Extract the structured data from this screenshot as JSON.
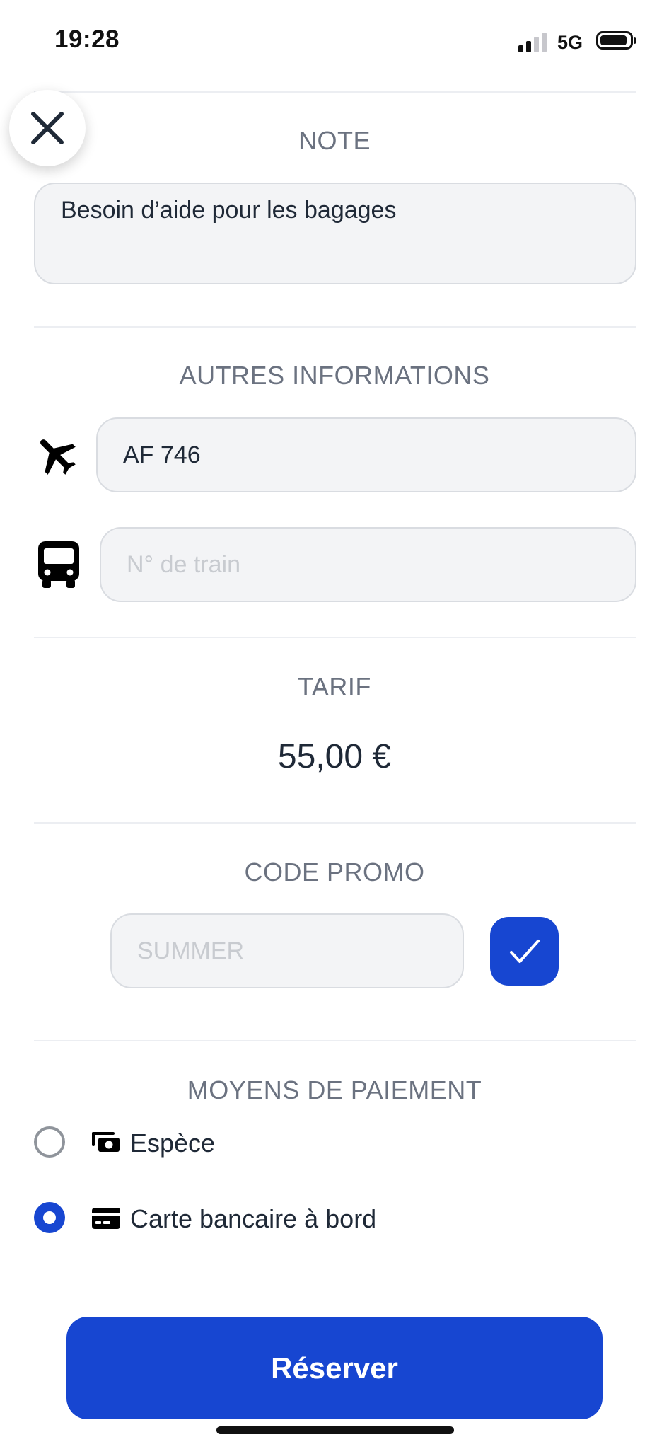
{
  "status_bar": {
    "time": "19:28",
    "network": "5G"
  },
  "note": {
    "title": "NOTE",
    "value": "Besoin d’aide pour les bagages"
  },
  "other_info": {
    "title": "AUTRES INFORMATIONS",
    "flight_value": "AF 746",
    "train_placeholder": "N° de train",
    "flight_icon": "airplane-icon",
    "train_icon": "bus-icon"
  },
  "tarif": {
    "title": "TARIF",
    "price": "55,00 €"
  },
  "promo": {
    "title": "CODE PROMO",
    "placeholder": "SUMMER",
    "confirm_icon": "checkmark-icon"
  },
  "payment": {
    "title": "MOYENS DE PAIEMENT",
    "options": [
      {
        "label": "Espèce",
        "icon": "cash-icon",
        "selected": false
      },
      {
        "label": "Carte bancaire à bord",
        "icon": "credit-card-icon",
        "selected": true
      }
    ]
  },
  "actions": {
    "reserve_label": "Réserver"
  },
  "colors": {
    "accent": "#1746d1",
    "field_bg": "#f3f4f6",
    "muted_text": "#6b7280"
  }
}
